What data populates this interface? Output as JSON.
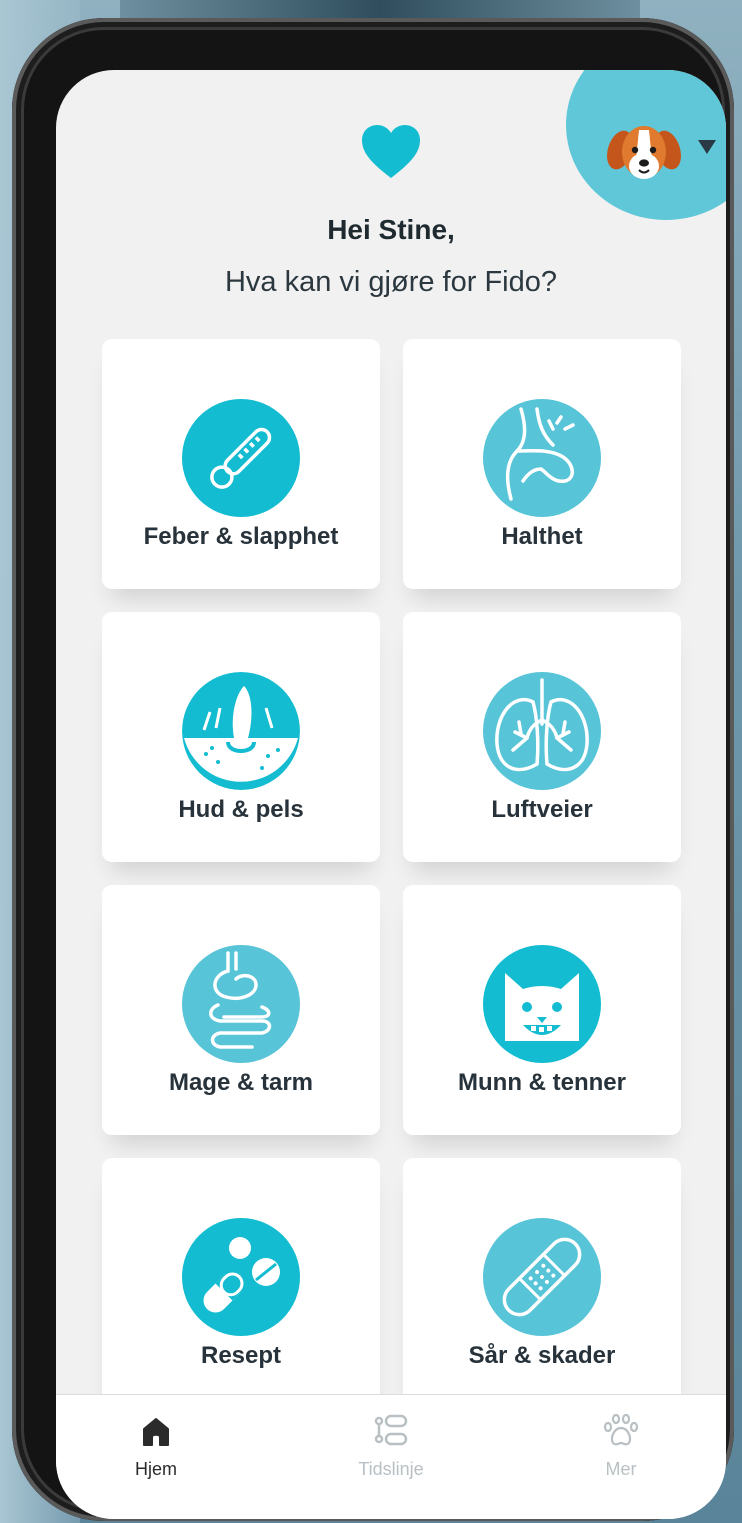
{
  "greeting": "Hei Stine,",
  "subtitle": "Hva kan vi gjøre for Fido?",
  "accent_color": "#13bcd0",
  "cards": [
    {
      "label": "Feber & slapphet",
      "icon": "thermometer-icon"
    },
    {
      "label": "Halthet",
      "icon": "paw-leg-icon"
    },
    {
      "label": "Hud & pels",
      "icon": "skin-hair-icon"
    },
    {
      "label": "Luftveier",
      "icon": "lungs-icon"
    },
    {
      "label": "Mage & tarm",
      "icon": "stomach-icon"
    },
    {
      "label": "Munn & tenner",
      "icon": "cat-face-icon"
    },
    {
      "label": "Resept",
      "icon": "pills-icon"
    },
    {
      "label": "Sår & skader",
      "icon": "bandage-icon"
    }
  ],
  "nav": {
    "items": [
      {
        "label": "Hjem",
        "icon": "home-icon",
        "active": true
      },
      {
        "label": "Tidslinje",
        "icon": "timeline-icon",
        "active": false
      },
      {
        "label": "Mer",
        "icon": "paw-icon",
        "active": false
      }
    ]
  }
}
